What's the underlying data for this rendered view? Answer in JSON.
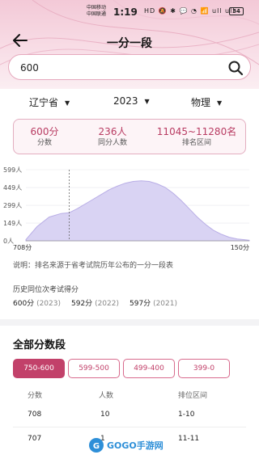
{
  "status_bar": {
    "carrier_1": "中国移动",
    "carrier_2": "中国联通",
    "time": "1:19",
    "icons": "HD 🔕 ✱ 💬 ◔ 📶 ull ull",
    "battery": "34"
  },
  "nav": {
    "title": "一分一段",
    "back_icon": "arrow-left-icon"
  },
  "search": {
    "value": "600",
    "placeholder": "",
    "icon": "search-icon"
  },
  "filters": [
    {
      "label": "辽宁省"
    },
    {
      "label": "2023"
    },
    {
      "label": "物理"
    }
  ],
  "stats": [
    {
      "value": "600分",
      "label": "分数"
    },
    {
      "value": "236人",
      "label": "同分人数"
    },
    {
      "value": "11045~11280名",
      "label": "排名区间"
    }
  ],
  "chart_data": {
    "type": "area",
    "y_ticks": [
      "599人",
      "449人",
      "299人",
      "149人",
      "0人"
    ],
    "ylim": [
      0,
      599
    ],
    "x_start_label": "708分",
    "x_end_label": "150分",
    "marker_score": 600,
    "x": [
      708,
      680,
      650,
      620,
      600,
      580,
      550,
      520,
      500,
      480,
      460,
      440,
      420,
      400,
      380,
      360,
      340,
      320,
      300,
      280,
      260,
      240,
      220,
      200,
      180,
      160,
      150
    ],
    "values": [
      10,
      120,
      200,
      230,
      236,
      270,
      330,
      390,
      430,
      460,
      485,
      500,
      505,
      500,
      480,
      450,
      400,
      340,
      270,
      200,
      140,
      90,
      55,
      30,
      15,
      8,
      5
    ],
    "grid": true,
    "color": "#b9aee6"
  },
  "note": "说明：排名来源于省考试院历年公布的一分一段表",
  "history": {
    "title": "历史同位次考试得分",
    "items": [
      {
        "score": "600分",
        "year": "(2023)"
      },
      {
        "score": "592分",
        "year": "(2022)"
      },
      {
        "score": "597分",
        "year": "(2021)"
      }
    ]
  },
  "section": {
    "title": "全部分数段",
    "tabs": [
      "750-600",
      "599-500",
      "499-400",
      "399-0"
    ],
    "active_tab": "750-600"
  },
  "table": {
    "headers": [
      "分数",
      "人数",
      "排位区间"
    ],
    "rows": [
      [
        "708",
        "10",
        "1-10"
      ],
      [
        "707",
        "1",
        "11-11"
      ]
    ]
  },
  "watermark": "GOGO手游网",
  "colors": {
    "accent": "#c2416a",
    "header_bg": "#f3c9d7",
    "chart_fill": "#b9aee6"
  }
}
